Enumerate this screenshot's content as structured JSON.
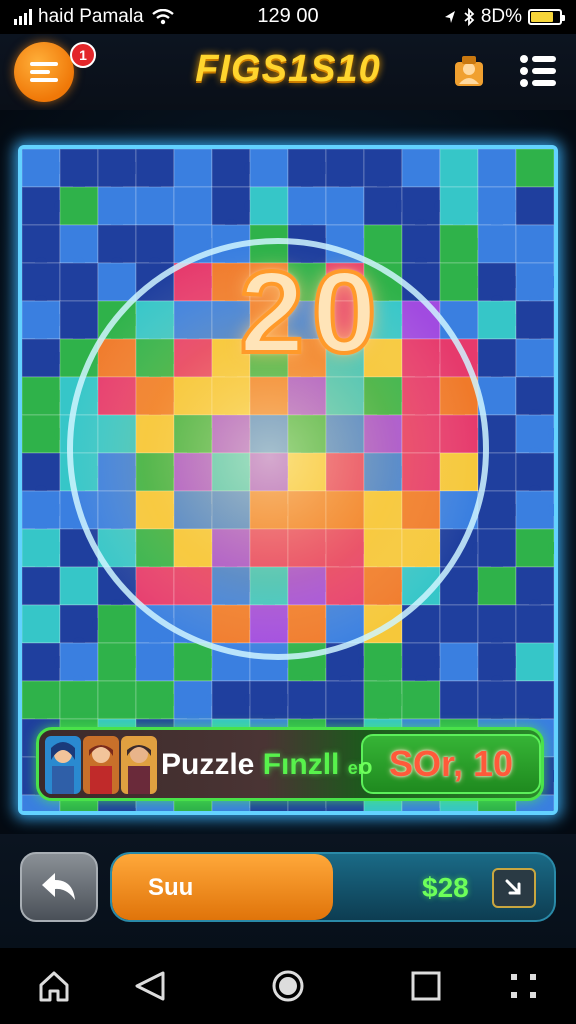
{
  "status_bar": {
    "carrier": "haid Pamala",
    "time": "129 00",
    "battery": "8D%"
  },
  "header": {
    "title": "FIGS1S10",
    "notification_count": "1",
    "menu_icon": "menu-icon",
    "profile_icon": "profile-icon",
    "list_icon": "list-icon"
  },
  "board": {
    "big_score": "20",
    "theme_colors": [
      "#e63a6c",
      "#f6c83a",
      "#2fb24a",
      "#3a7fe0",
      "#a14be0",
      "#f07a2a",
      "#36c6c8",
      "#1f3f9e"
    ]
  },
  "info_bar": {
    "label_word1": "Puzzle",
    "label_word2": "Fınzll",
    "label_tail": "er",
    "label_tail2": "o",
    "score": "SOr, 10"
  },
  "action_bar": {
    "progress_label": "Suu",
    "progress_fraction": 0.5,
    "coin_value": "$28",
    "back_icon": "back-arrow-icon",
    "collapse_icon": "collapse-icon"
  },
  "nav_bar": {
    "items": [
      "home-icon",
      "back-triangle-icon",
      "circle-home-icon",
      "recent-apps-icon",
      "drag-dots-icon"
    ]
  }
}
